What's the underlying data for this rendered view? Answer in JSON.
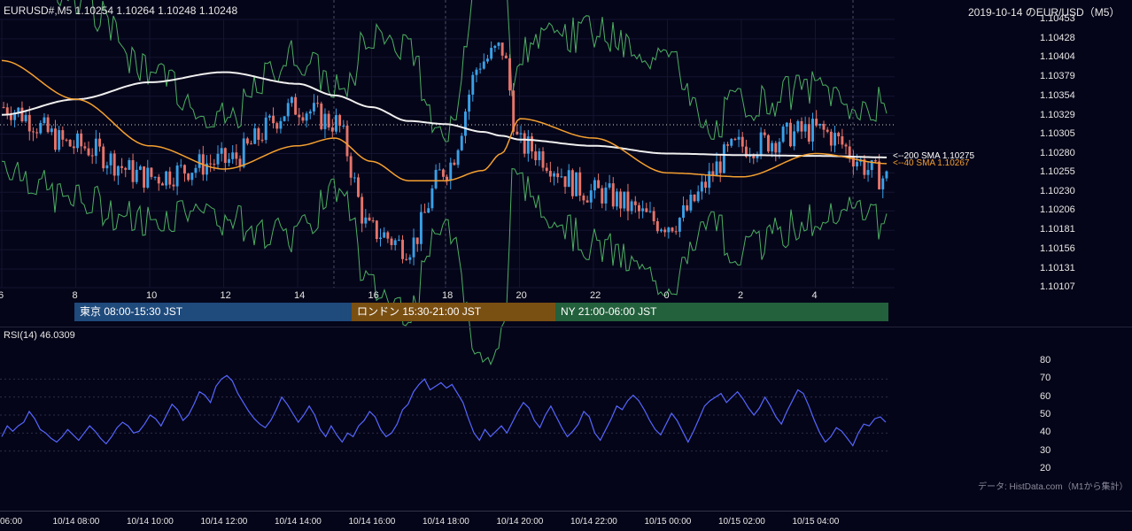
{
  "header": {
    "symbol_info": "EURUSD#,M5 1.10254 1.10264 1.10248 1.10248",
    "date_title": "2019-10-14 のEUR/USD（M5）"
  },
  "price_axis": [
    "1.10453",
    "1.10428",
    "1.10404",
    "1.10379",
    "1.10354",
    "1.10329",
    "1.10305",
    "1.10280",
    "1.10255",
    "1.10230",
    "1.10206",
    "1.10181",
    "1.10156",
    "1.10131",
    "1.10107"
  ],
  "hour_axis": [
    "6",
    "8",
    "10",
    "12",
    "14",
    "16",
    "18",
    "20",
    "22",
    "0",
    "2",
    "4"
  ],
  "sessions": [
    {
      "label": "東京 08:00-15:30 JST",
      "color": "#1f4a7c"
    },
    {
      "label": "ロンドン 15:30-21:00 JST",
      "color": "#7a4f12"
    },
    {
      "label": "NY 21:00-06:00 JST",
      "color": "#23603c"
    }
  ],
  "ma_labels": {
    "sma200": "<--200 SMA 1.10275",
    "sma40": "<--40 SMA 1.10267"
  },
  "rsi": {
    "label": "RSI(14) 46.0309",
    "axis": [
      "80",
      "70",
      "60",
      "50",
      "40",
      "30",
      "20"
    ]
  },
  "time_axis": [
    "06:00",
    "10/14 08:00",
    "10/14 10:00",
    "10/14 12:00",
    "10/14 14:00",
    "10/14 16:00",
    "10/14 18:00",
    "10/14 20:00",
    "10/14 22:00",
    "10/15 00:00",
    "10/15 02:00",
    "10/15 04:00"
  ],
  "source_note": "データ: HistData.com（M1から集計）",
  "colors": {
    "bg": "#050519",
    "up": "#3aa0e6",
    "down": "#e5746a",
    "sma200": "#f0f0f0",
    "sma40": "#f5a030",
    "band": "#4caf62",
    "rsi": "#5566ff"
  },
  "chart_data": {
    "type": "line",
    "title": "2019-10-14 のEUR/USD（M5）",
    "ylim": [
      1.10107,
      1.10453
    ],
    "x": [
      "06:00",
      "08:00",
      "10:00",
      "12:00",
      "14:00",
      "15:00",
      "16:00",
      "17:00",
      "18:00",
      "19:00",
      "19:30",
      "20:00",
      "22:00",
      "00:00",
      "02:00",
      "04:00",
      "05:30"
    ],
    "series": [
      {
        "name": "SMA 200",
        "values": [
          1.1033,
          1.1035,
          1.10372,
          1.10385,
          1.1037,
          1.10355,
          1.1034,
          1.10322,
          1.10318,
          1.10308,
          1.10303,
          1.10298,
          1.1029,
          1.1028,
          1.10278,
          1.10277,
          1.10275
        ]
      },
      {
        "name": "SMA 40",
        "values": [
          1.104,
          1.1035,
          1.1029,
          1.1026,
          1.1029,
          1.103,
          1.1027,
          1.10245,
          1.10245,
          1.10258,
          1.1028,
          1.10325,
          1.103,
          1.10255,
          1.1025,
          1.1028,
          1.10267
        ]
      },
      {
        "name": "Close",
        "values": [
          1.1034,
          1.1029,
          1.1025,
          1.1027,
          1.1034,
          1.1032,
          1.1018,
          1.1016,
          1.1026,
          1.104,
          1.10415,
          1.1029,
          1.1023,
          1.1019,
          1.1029,
          1.1031,
          1.10248
        ]
      }
    ]
  },
  "rsi_data": {
    "ylim": [
      20,
      80
    ],
    "values": [
      38,
      44,
      41,
      44,
      46,
      52,
      48,
      42,
      40,
      37,
      35,
      38,
      42,
      39,
      36,
      40,
      44,
      41,
      37,
      34,
      38,
      43,
      46,
      44,
      40,
      41,
      45,
      50,
      48,
      44,
      50,
      56,
      53,
      47,
      50,
      56,
      63,
      61,
      57,
      66,
      70,
      72,
      69,
      62,
      57,
      52,
      48,
      45,
      43,
      47,
      53,
      60,
      56,
      51,
      46,
      50,
      55,
      50,
      42,
      38,
      44,
      39,
      35,
      40,
      38,
      44,
      47,
      52,
      49,
      42,
      38,
      40,
      45,
      53,
      56,
      63,
      67,
      70,
      64,
      66,
      68,
      65,
      67,
      62,
      57,
      48,
      40,
      36,
      42,
      38,
      41,
      44,
      40,
      46,
      52,
      57,
      54,
      47,
      43,
      50,
      55,
      49,
      43,
      38,
      41,
      45,
      52,
      49,
      40,
      36,
      42,
      48,
      55,
      53,
      58,
      61,
      58,
      53,
      47,
      42,
      39,
      45,
      51,
      47,
      41,
      35,
      41,
      48,
      55,
      58,
      60,
      62,
      57,
      60,
      63,
      59,
      54,
      50,
      54,
      60,
      55,
      49,
      45,
      52,
      58,
      64,
      62,
      55,
      47,
      40,
      35,
      38,
      43,
      41,
      37,
      33,
      40,
      45,
      44,
      48,
      49,
      46
    ]
  },
  "candle_data": {
    "count": 240,
    "seed": 7
  }
}
